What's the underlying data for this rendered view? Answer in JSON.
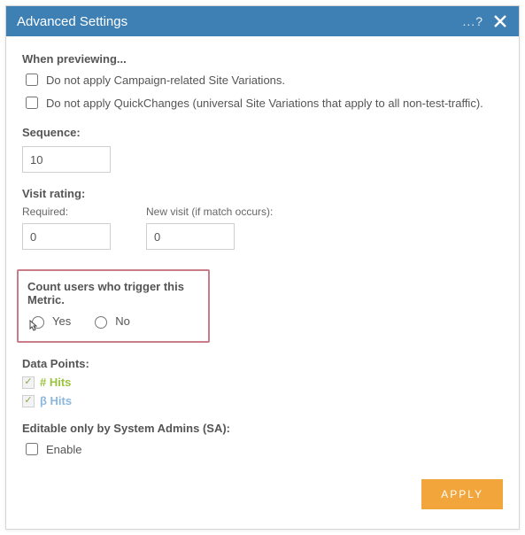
{
  "titlebar": {
    "title": "Advanced Settings",
    "help_dots": "...?"
  },
  "preview": {
    "heading": "When previewing...",
    "opt_campaign": "Do not apply Campaign-related Site Variations.",
    "opt_quickchanges": "Do not apply QuickChanges (universal Site Variations that apply to all non-test-traffic)."
  },
  "sequence": {
    "label": "Sequence:",
    "value": "10"
  },
  "visit_rating": {
    "label": "Visit rating:",
    "required_label": "Required:",
    "required_value": "0",
    "new_visit_label": "New visit (if match occurs):",
    "new_visit_value": "0"
  },
  "count_metric": {
    "label": "Count users who trigger this Metric.",
    "yes": "Yes",
    "no": "No"
  },
  "data_points": {
    "label": "Data Points:",
    "hits": "# Hits",
    "beta": "β Hits"
  },
  "editable_sa": {
    "label": "Editable only by System Admins (SA):",
    "enable": "Enable"
  },
  "footer": {
    "apply": "APPLY"
  }
}
